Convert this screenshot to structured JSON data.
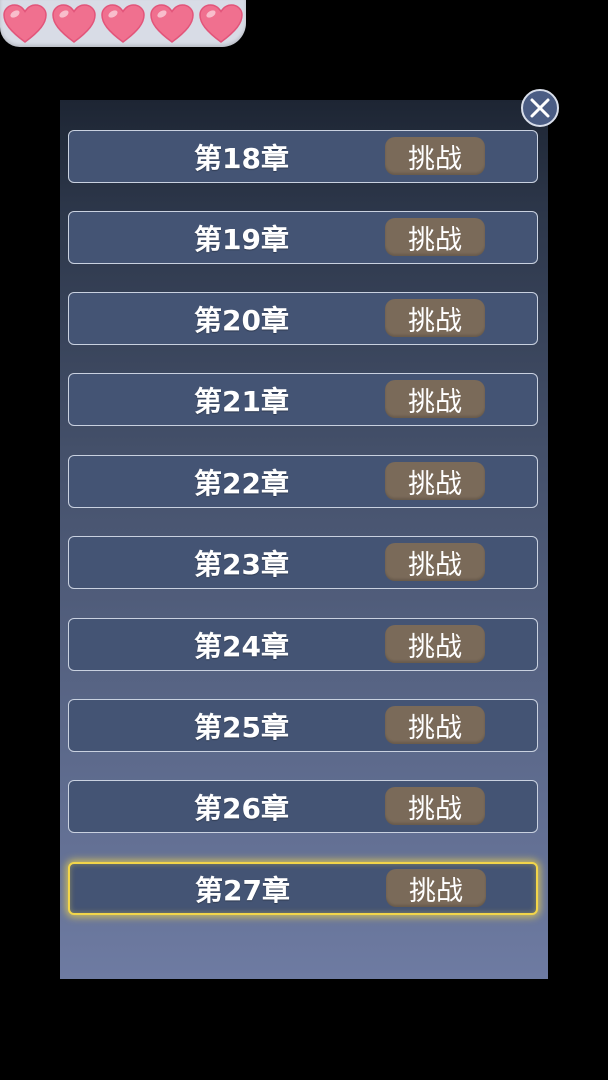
{
  "hearts": {
    "count": 5,
    "color": "#f0708f"
  },
  "panel": {
    "accent_selected": "#f2d54a",
    "button_color": "#7a6a59"
  },
  "chapters": [
    {
      "label": "第18章",
      "button": "挑战",
      "selected": false
    },
    {
      "label": "第19章",
      "button": "挑战",
      "selected": false
    },
    {
      "label": "第20章",
      "button": "挑战",
      "selected": false
    },
    {
      "label": "第21章",
      "button": "挑战",
      "selected": false
    },
    {
      "label": "第22章",
      "button": "挑战",
      "selected": false
    },
    {
      "label": "第23章",
      "button": "挑战",
      "selected": false
    },
    {
      "label": "第24章",
      "button": "挑战",
      "selected": false
    },
    {
      "label": "第25章",
      "button": "挑战",
      "selected": false
    },
    {
      "label": "第26章",
      "button": "挑战",
      "selected": false
    },
    {
      "label": "第27章",
      "button": "挑战",
      "selected": true
    }
  ],
  "close_icon": "close-icon"
}
